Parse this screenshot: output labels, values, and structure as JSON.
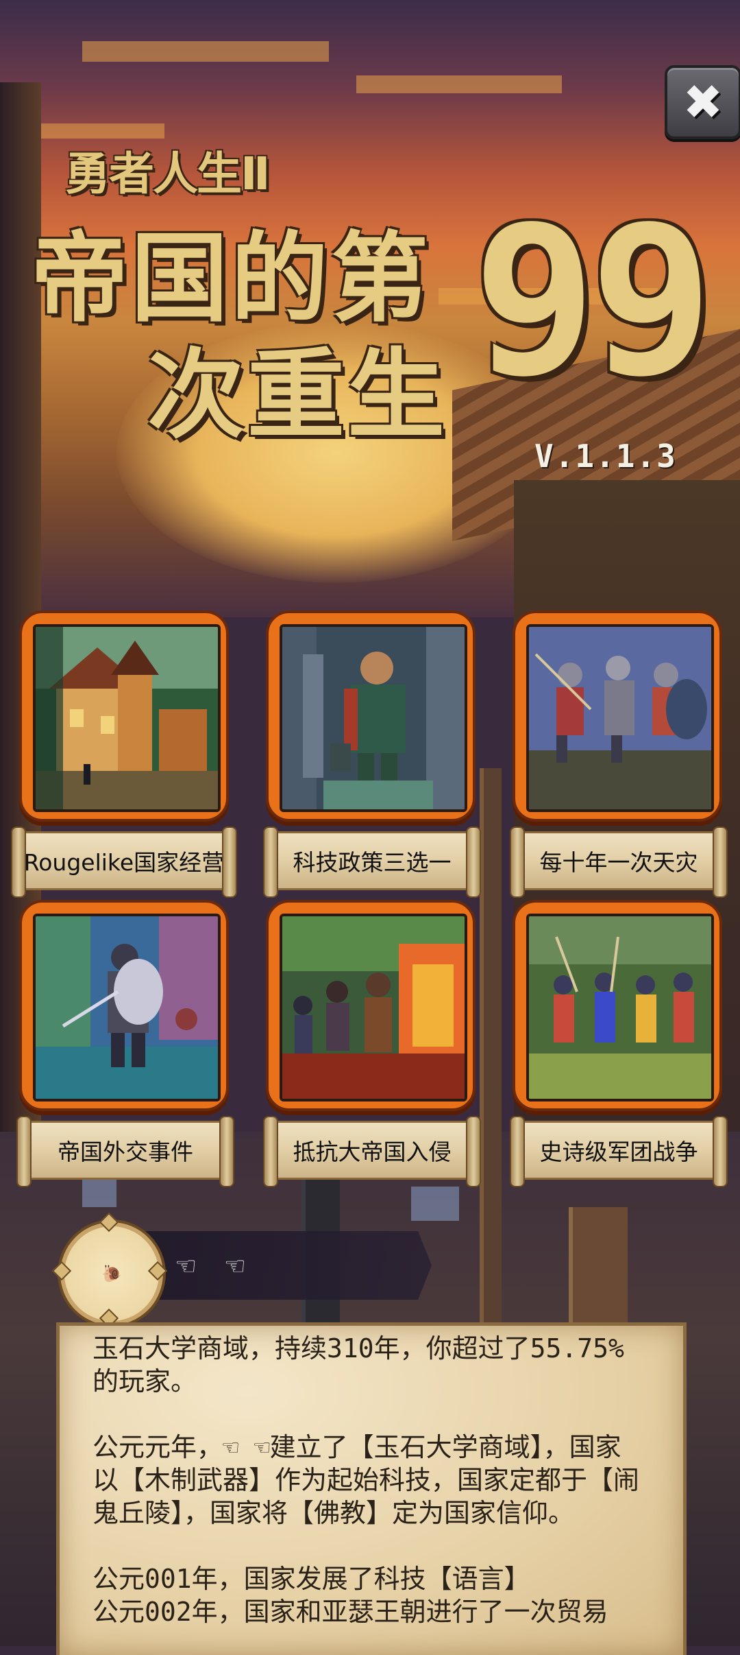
{
  "header": {
    "subtitle": "勇者人生Ⅱ",
    "title_line1": "帝国的第",
    "title_line2": "次重生",
    "title_number": "99",
    "version": "V.1.1.3"
  },
  "close_button": {
    "icon": "close-icon",
    "label": "✖"
  },
  "features": [
    {
      "label": "Rougelike国家经营",
      "art": "medieval-village"
    },
    {
      "label": "科技政策三选一",
      "art": "statue-knight"
    },
    {
      "label": "每十年一次天灾",
      "art": "charging-soldiers"
    },
    {
      "label": "帝国外交事件",
      "art": "armored-knight"
    },
    {
      "label": "抵抗大帝国入侵",
      "art": "burning-battle"
    },
    {
      "label": "史诗级军团战争",
      "art": "army-march"
    }
  ],
  "player": {
    "avatar_icon": "snail-avatar-icon",
    "avatar_glyph": "🐌",
    "name": "☜ ☜"
  },
  "log": {
    "summary": "玉石大学商域，持续310年，你超过了55.75%的玩家。",
    "paragraph1": "公元元年，☜ ☜建立了【玉石大学商域】，国家以【木制武器】作为起始科技，国家定都于【闹鬼丘陵】，国家将【佛教】定为国家信仰。",
    "entry1": "公元001年，国家发展了科技【语言】",
    "entry2": "公元002年，国家和亚瑟王朝进行了一次贸易"
  },
  "colors": {
    "card_frame": "#e8711a",
    "title_gold": "#e6cc82",
    "parchment": "#e7d2a8"
  }
}
